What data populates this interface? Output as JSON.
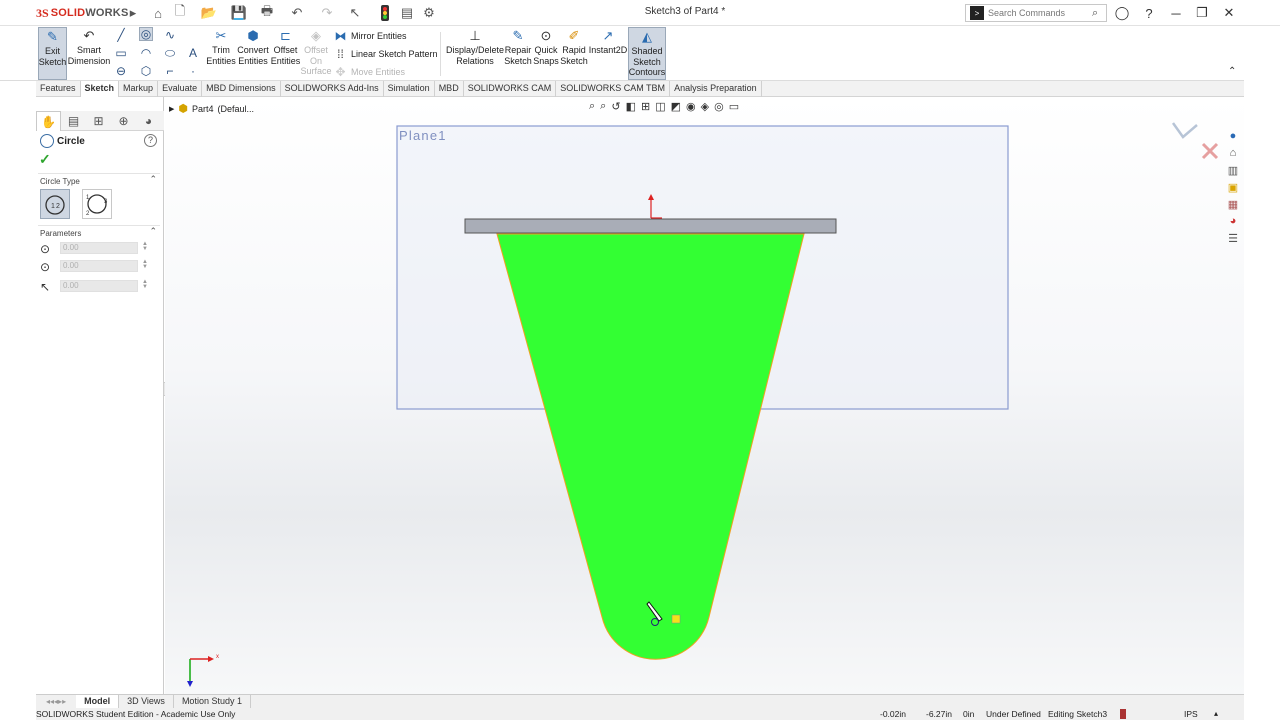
{
  "app": {
    "logo_ds": "3S",
    "logo_brand_a": "SOLID",
    "logo_brand_b": "WORKS",
    "doc_title": "Sketch3 of Part4 *"
  },
  "search": {
    "placeholder": "Search Commands"
  },
  "ribbon": {
    "exit_sketch": [
      "Exit",
      "Sketch"
    ],
    "smart_dimension": [
      "Smart",
      "Dimension"
    ],
    "trim": [
      "Trim",
      "Entities"
    ],
    "convert": [
      "Convert",
      "Entities"
    ],
    "offset": [
      "Offset",
      "Entities"
    ],
    "offset_surface": [
      "Offset",
      "On",
      "Surface"
    ],
    "mirror": "Mirror Entities",
    "linear_pattern": "Linear Sketch Pattern",
    "move": "Move Entities",
    "display_delete": [
      "Display/Delete",
      "Relations"
    ],
    "repair": [
      "Repair",
      "Sketch"
    ],
    "quick_snaps": [
      "Quick",
      "Snaps"
    ],
    "rapid": [
      "Rapid",
      "Sketch"
    ],
    "instant2d": "Instant2D",
    "shaded": [
      "Shaded",
      "Sketch",
      "Contours"
    ]
  },
  "tabs": [
    "Features",
    "Sketch",
    "Markup",
    "Evaluate",
    "MBD Dimensions",
    "SOLIDWORKS Add-Ins",
    "Simulation",
    "MBD",
    "SOLIDWORKS CAM",
    "SOLIDWORKS CAM TBM",
    "Analysis Preparation"
  ],
  "active_tab": "Sketch",
  "property_manager": {
    "title": "Circle",
    "help": "?",
    "circle_type_label": "Circle Type",
    "parameters_label": "Parameters",
    "param_x": "0.00",
    "param_y": "0.00",
    "param_r": "0.00"
  },
  "tree": {
    "root": "Part4",
    "config": "(Defaul..."
  },
  "graphics": {
    "plane_label": "Plane1",
    "sketch_fill": "#33ff33",
    "plate_color": "#a9adb7"
  },
  "bottom_tabs": [
    "Model",
    "3D Views",
    "Motion Study 1"
  ],
  "status": {
    "edition": "SOLIDWORKS Student Edition - Academic Use Only",
    "x": "-0.02in",
    "y": "-6.27in",
    "z": "0in",
    "state": "Under Defined",
    "editing": "Editing Sketch3",
    "units": "IPS"
  }
}
